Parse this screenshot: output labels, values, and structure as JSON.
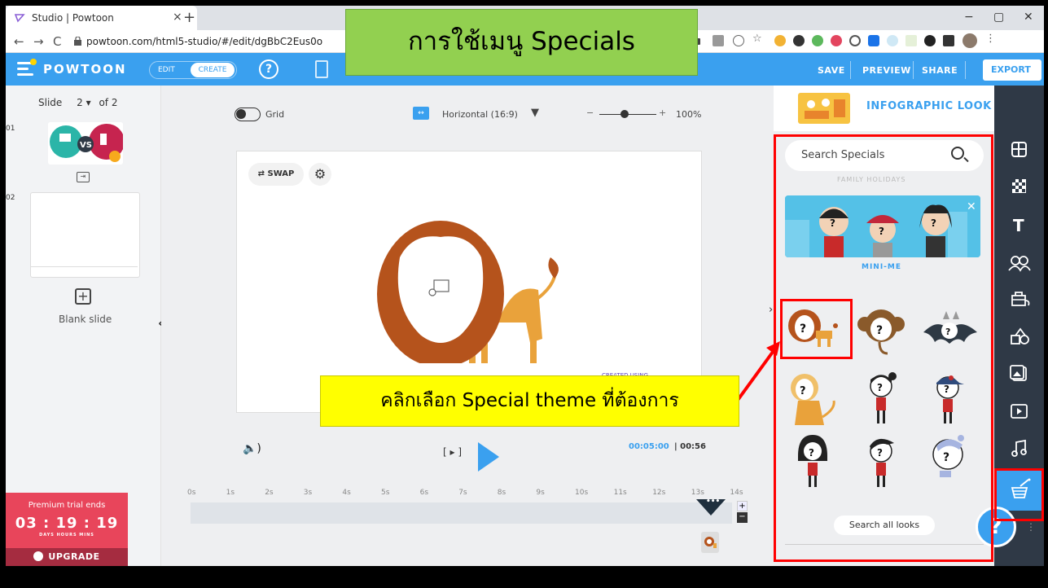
{
  "browser": {
    "tab_title": "Studio | Powtoon",
    "tab_close": "×",
    "new_tab": "+",
    "url": "powtoon.com/html5-studio/#/edit/dgBbC2Eus0o",
    "back": "←",
    "forward": "→",
    "reload": "C",
    "minimize": "−",
    "maximize": "▢",
    "close": "✕"
  },
  "header": {
    "logo": "POWTOON",
    "mode_edit": "EDIT",
    "mode_create": "CREATE",
    "help": "?",
    "save": "SAVE",
    "preview": "PREVIEW",
    "share": "SHARE",
    "export": "EXPORT",
    "export_caret": "⌄"
  },
  "overlay_title": "การใช้เมนู Specials",
  "slides": {
    "slide_label": "Slide",
    "current": "2",
    "caret": "▾",
    "of_label": "of 2",
    "num1": "01",
    "num2": "02",
    "thumb1_text": "VS",
    "blank_plus": "+",
    "blank_label": "Blank slide",
    "collapse": "‹"
  },
  "premium": {
    "title": "Premium trial ends",
    "timer": "03 : 19 : 19",
    "labels": "DAYS    HOURS    MINS",
    "upgrade": "UPGRADE"
  },
  "toolbar": {
    "grid_label": "Grid",
    "orientation": "Horizontal (16:9)",
    "orientation_caret": "▼",
    "zoom_minus": "−",
    "zoom_plus": "+",
    "zoom_value": "100%"
  },
  "stage": {
    "swap": "SWAP",
    "created_badge": "CREATED USING"
  },
  "playback": {
    "speaker": "🔈)",
    "bracket_play": "[ ▸ ]",
    "time_current": "00:05:00",
    "time_total": "00:56",
    "ruler": [
      "0s",
      "1s",
      "2s",
      "3s",
      "4s",
      "5s",
      "6s",
      "7s",
      "8s",
      "9s",
      "10s",
      "11s",
      "12s",
      "13s",
      "14s"
    ],
    "tl_plus": "+",
    "tl_minus": "−",
    "playhead_dots": "•••"
  },
  "callout": "คลิกเลือก Special theme ที่ต้องการ",
  "right_panel": {
    "look_label": "INFOGRAPHIC LOOK",
    "look_caret": "▼",
    "search_placeholder": "Search Specials",
    "faded_section": "FAMILY HOLIDAYS",
    "section_label": "MINI-ME",
    "search_all": "Search all looks"
  },
  "iconbar": {
    "icons": [
      "layout-icon",
      "background-icon",
      "text-icon",
      "characters-icon",
      "props-icon",
      "shapes-icon",
      "media-icon",
      "video-icon",
      "music-icon",
      "specials-icon"
    ]
  },
  "help_fab": "?",
  "colors": {
    "brand_blue": "#3aa0ef",
    "premium_red": "#e8455b",
    "highlight_red": "#ff0000",
    "title_green": "#92d050",
    "callout_yellow": "#ffff00",
    "lion_brown": "#b5531c",
    "lion_tan": "#e9a23b"
  }
}
